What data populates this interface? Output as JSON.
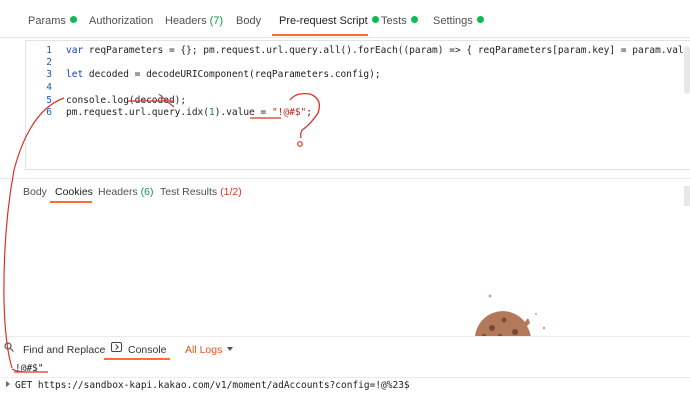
{
  "request_tabs": [
    {
      "label": "Params",
      "dot": true
    },
    {
      "label": "Authorization"
    },
    {
      "label": "Headers",
      "count": "(7)"
    },
    {
      "label": "Body"
    },
    {
      "label": "Pre-request Script",
      "dot": true,
      "active": true
    },
    {
      "label": "Tests",
      "dot": true
    },
    {
      "label": "Settings",
      "dot": true
    }
  ],
  "editor": {
    "line_numbers": [
      "1",
      "2",
      "3",
      "4",
      "5",
      "6"
    ],
    "line1": {
      "kw": "var",
      "rest": " reqParameters = {}; pm.request.url.query.all().forEach((param) => { reqParameters[param.key] = param.value });"
    },
    "line3": {
      "kw": "let",
      "rest": " decoded = decodeURIComponent(reqParameters.config);"
    },
    "line5": "console.log(decoded);",
    "line6": {
      "a": "pm.request.url.query.idx(",
      "num": "1",
      "b": ").value = ",
      "str": "\"!@#$\"",
      "c": ";"
    }
  },
  "response_tabs": [
    {
      "label": "Body"
    },
    {
      "label": "Cookies",
      "active": true
    },
    {
      "label": "Headers",
      "count": "(6)"
    },
    {
      "label": "Test Results",
      "count": "(1/2)",
      "error": true
    }
  ],
  "console_bar": {
    "find_replace": "Find and Replace",
    "console": "Console",
    "logs_filter": "All Logs"
  },
  "console_output": {
    "log": "!@#$\"",
    "request": "GET https://sandbox-kapi.kakao.com/v1/moment/adAccounts?config=!@%23$"
  },
  "colors": {
    "accent": "#ff6c37",
    "success_dot": "#0cbb52",
    "annotation_red": "#d8342a"
  }
}
